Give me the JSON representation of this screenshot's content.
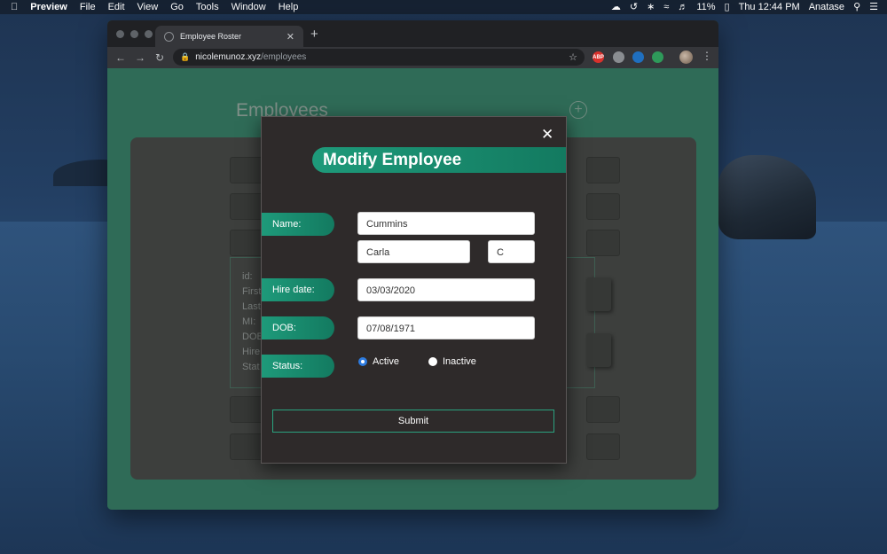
{
  "menubar": {
    "app": "Preview",
    "menus": [
      "File",
      "Edit",
      "View",
      "Go",
      "Tools",
      "Window",
      "Help"
    ],
    "battery": "11%",
    "clock": "Thu 12:44 PM",
    "user": "Anatase"
  },
  "browser": {
    "tab_title": "Employee Roster",
    "url_host": "nicolemunoz.xyz",
    "url_path": "/employees",
    "extensions": [
      "ABP"
    ]
  },
  "page": {
    "title": "Employees",
    "detail_labels": [
      "id:",
      "First",
      "Last",
      "MI:",
      "DOB",
      "Hire",
      "Stat"
    ]
  },
  "modal": {
    "title": "Modify Employee",
    "labels": {
      "name": "Name:",
      "hire_date": "Hire date:",
      "dob": "DOB:",
      "status": "Status:"
    },
    "fields": {
      "last_name": "Cummins",
      "first_name": "Carla",
      "middle_initial": "C",
      "hire_date": "03/03/2020",
      "dob": "07/08/1971"
    },
    "status_options": [
      "Active",
      "Inactive"
    ],
    "selected_status": "Active",
    "submit_label": "Submit"
  }
}
